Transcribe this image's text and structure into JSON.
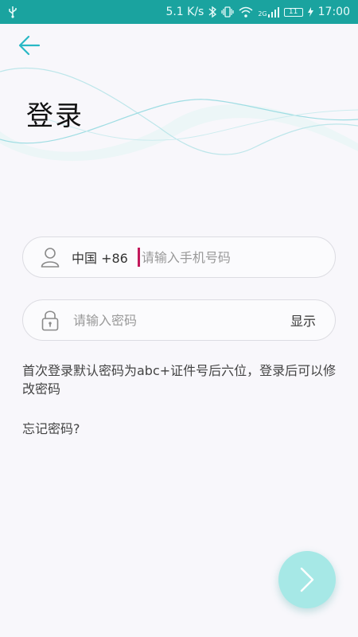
{
  "status_bar": {
    "speed": "5.1 K/s",
    "network": "2G",
    "battery": "11",
    "time": "17:00"
  },
  "page": {
    "title": "登录"
  },
  "login": {
    "country_code": "中国 +86",
    "phone_placeholder": "请输入手机号码",
    "password_placeholder": "请输入密码",
    "show_label": "显示",
    "notice": "首次登录默认密码为abc+证件号后六位，登录后可以修改密码",
    "forgot": "忘记密码?"
  },
  "colors": {
    "status_bar": "#1aa39f",
    "accent": "#29b8c5",
    "next_button": "#a6e8e6",
    "caret": "#c2185b"
  },
  "icons": {
    "back": "back-arrow-icon",
    "user": "user-icon",
    "lock": "lock-icon",
    "next": "chevron-right-icon"
  }
}
